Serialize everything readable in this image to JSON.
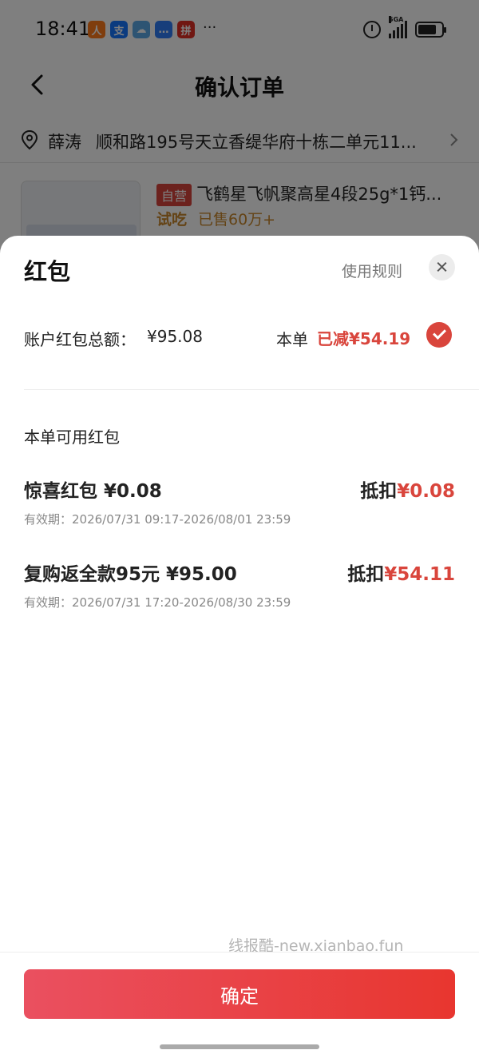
{
  "status_bar": {
    "time": "18:41",
    "network": "5GA",
    "app_icons": [
      {
        "name": "taobao-app-icon",
        "glyph": "人",
        "color": "#ff7a1a"
      },
      {
        "name": "alipay-app-icon",
        "glyph": "支",
        "color": "#1677ff"
      },
      {
        "name": "weather-app-icon",
        "glyph": "☁",
        "color": "#5aa9e6"
      },
      {
        "name": "message-app-icon",
        "glyph": "…",
        "color": "#2f7df6"
      },
      {
        "name": "pinduoduo-app-icon",
        "glyph": "拼",
        "color": "#e02e24"
      }
    ],
    "more": "···"
  },
  "nav": {
    "title": "确认订单"
  },
  "address": {
    "name": "薛涛",
    "detail": "顺和路195号天立香缇华府十栋二单元11..."
  },
  "product": {
    "tag": "自营",
    "title": "飞鹤星飞帆聚高星4段25g*1钙...",
    "trial": "试吃",
    "sold": "已售60万+"
  },
  "sheet": {
    "title": "红包",
    "rules_label": "使用规则",
    "balance_label": "账户红包总额：",
    "balance_value": "¥95.08",
    "order_label": "本单",
    "order_reduced": "已减¥54.19",
    "section_label": "本单可用红包",
    "items": [
      {
        "name": "惊喜红包 ¥0.08",
        "validity": "有效期：2026/07/31 09:17-2026/08/01 23:59",
        "deduct_label": "抵扣",
        "deduct_amount": "¥0.08"
      },
      {
        "name": "复购返全款95元 ¥95.00",
        "validity": "有效期：2026/07/31 17:20-2026/08/30 23:59",
        "deduct_label": "抵扣",
        "deduct_amount": "¥54.11"
      }
    ],
    "watermark": "线报酷-new.xianbao.fun",
    "confirm_label": "确定"
  },
  "colors": {
    "accent": "#d9453c",
    "button_gradient_start": "#ea5060",
    "button_gradient_end": "#e8362f"
  }
}
